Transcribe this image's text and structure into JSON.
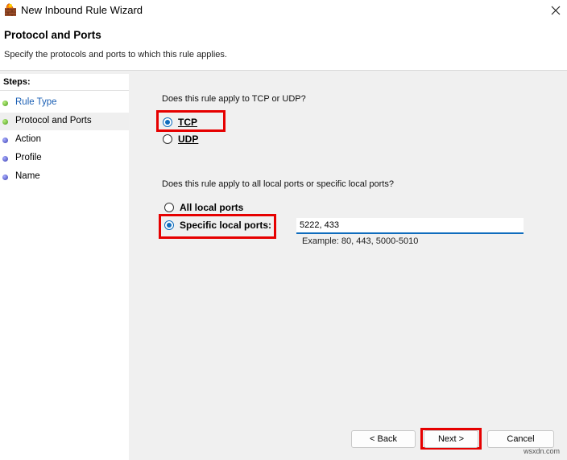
{
  "window": {
    "title": "New Inbound Rule Wizard",
    "close_glyph": "✕"
  },
  "header": {
    "title": "Protocol and Ports",
    "subtitle": "Specify the protocols and ports to which this rule applies."
  },
  "sidebar": {
    "heading": "Steps:",
    "steps": [
      {
        "label": "Rule Type",
        "state": "done"
      },
      {
        "label": "Protocol and Ports",
        "state": "current"
      },
      {
        "label": "Action",
        "state": "pending"
      },
      {
        "label": "Profile",
        "state": "pending"
      },
      {
        "label": "Name",
        "state": "pending"
      }
    ]
  },
  "protocol": {
    "question": "Does this rule apply to TCP or UDP?",
    "options": [
      {
        "label": "TCP",
        "checked": true
      },
      {
        "label": "UDP",
        "checked": false
      }
    ]
  },
  "ports": {
    "question": "Does this rule apply to all local ports or specific local ports?",
    "all_label": "All local ports",
    "specific_label": "Specific local ports:",
    "value": "5222, 433",
    "example": "Example: 80, 443, 5000-5010"
  },
  "buttons": {
    "back": "< Back",
    "next": "Next >",
    "cancel": "Cancel"
  },
  "watermark": "wsxdn.com",
  "colors": {
    "accent": "#0f6cbd",
    "highlight": "#e60000",
    "link": "#1a5fb4",
    "done_dot": "#4c9a1c",
    "pending_dot": "#3a3fb0"
  }
}
